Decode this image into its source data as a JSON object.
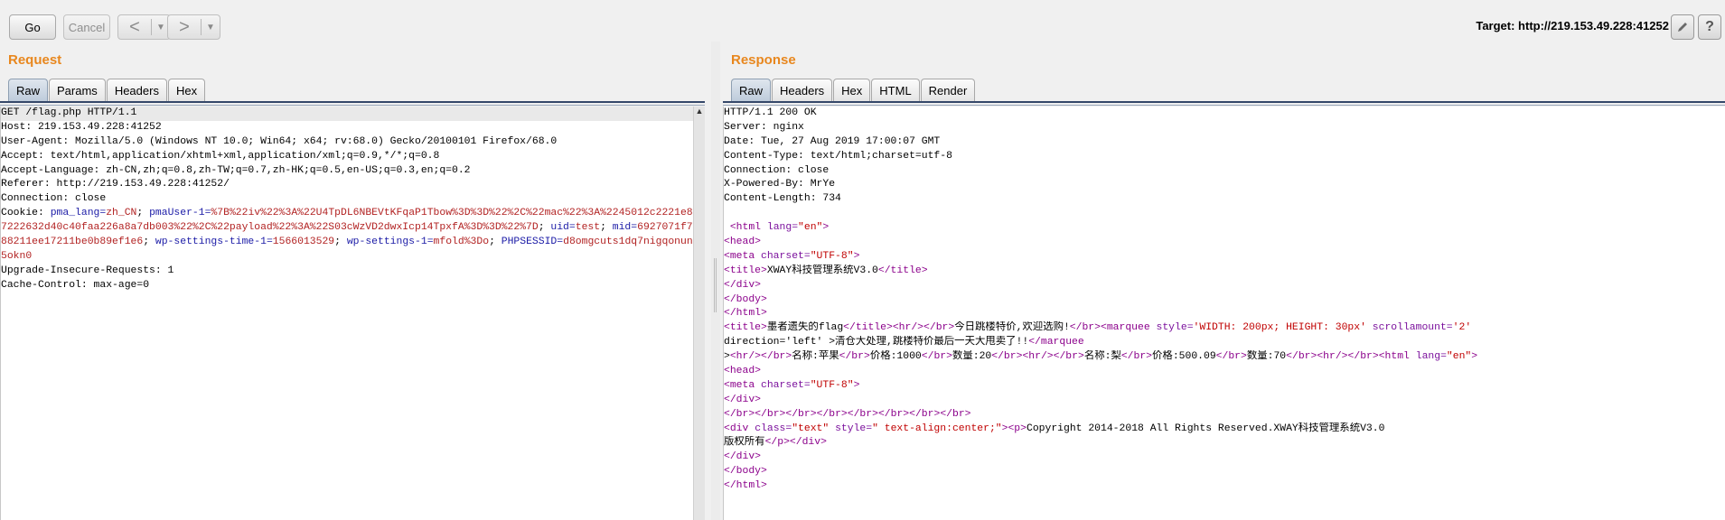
{
  "toolbar": {
    "go_label": "Go",
    "cancel_label": "Cancel",
    "back_glyph": "<",
    "forward_glyph": ">",
    "dropdown_glyph": "▼",
    "target_text": "Target: http://219.153.49.228:41252",
    "edit_icon": "pencil-icon",
    "help_icon": "help-icon"
  },
  "request": {
    "title": "Request",
    "tabs": [
      "Raw",
      "Params",
      "Headers",
      "Hex"
    ],
    "active_tab": "Raw",
    "lines": [
      "GET /flag.php HTTP/1.1",
      "Host: 219.153.49.228:41252",
      "User-Agent: Mozilla/5.0 (Windows NT 10.0; Win64; x64; rv:68.0) Gecko/20100101 Firefox/68.0",
      "Accept: text/html,application/xhtml+xml,application/xml;q=0.9,*/*;q=0.8",
      "Accept-Language: zh-CN,zh;q=0.8,zh-TW;q=0.7,zh-HK;q=0.5,en-US;q=0.3,en;q=0.2",
      "Referer: http://219.153.49.228:41252/",
      "Connection: close"
    ],
    "cookie_label": "Cookie: ",
    "cookie_parts": [
      {
        "k": "pma_lang",
        "v": "zh_CN",
        "sep": "; "
      },
      {
        "k": "pmaUser-1",
        "v": "%7B%22iv%22%3A%22U4TpDL6NBEVtKFqaP1Tbow%3D%3D%22%2C%22mac%22%3A%2245012c2221e87222632d40c40faa226a8a7db003%22%2C%22payload%22%3A%22S03cWzVD2dwxIcp14TpxfA%3D%3D%22%7D",
        "sep": "; "
      },
      {
        "k": "uid",
        "v": "test",
        "sep": "; "
      },
      {
        "k": "mid",
        "v": "6927071f788211ee17211be0b89ef1e6",
        "sep": "; "
      },
      {
        "k": "wp-settings-time-1",
        "v": "1566013529",
        "sep": "; "
      },
      {
        "k": "wp-settings-1",
        "v": "mfold%3Do",
        "sep": "; "
      },
      {
        "k": "PHPSESSID",
        "v": "d8omgcuts1dq7nigqonun5okn0",
        "sep": ""
      }
    ],
    "tail_lines": [
      "Upgrade-Insecure-Requests: 1",
      "Cache-Control: max-age=0"
    ]
  },
  "response": {
    "title": "Response",
    "tabs": [
      "Raw",
      "Headers",
      "Hex",
      "HTML",
      "Render"
    ],
    "active_tab": "Raw",
    "header_lines": [
      "HTTP/1.1 200 OK",
      "Server: nginx",
      "Date: Tue, 27 Aug 2019 17:00:07 GMT",
      "Content-Type: text/html;charset=utf-8",
      "Connection: close",
      "X-Powered-By: MrYe",
      "Content-Length: 734",
      ""
    ],
    "body_lines": [
      " <html lang=\"en\">",
      "<head>",
      "<meta charset=\"UTF-8\">",
      "<title>XWAY科技管理系统V3.0</title>",
      "</div>",
      "</body>",
      "</html>",
      "<title>墨者遗失的flag</title><hr/></br>今日跳楼特价,欢迎选购!</br><marquee style='WIDTH: 200px; HEIGHT: 30px' scrollamount='2'",
      "direction='left' >清仓大处理,跳楼特价最后一天大甩卖了!!</marquee",
      "><hr/></br>名称:苹果</br>价格:1000</br>数量:20</br><hr/></br>名称:梨</br>价格:500.09</br>数量:70</br><hr/></br><html lang=\"en\">",
      "<head>",
      "<meta charset=\"UTF-8\">",
      "</div>",
      "</br></br></br></br></br></br></br></br>",
      "<div class=\"text\" style=\" text-align:center;\"><p>Copyright 2014-2018 All Rights Reserved.XWAY科技管理系统V3.0",
      "版权所有</p></div>",
      "</div>",
      "</body>",
      "</html>"
    ]
  },
  "colors": {
    "panel_title": "#e8871e",
    "cookie_key": "#1a1aa6",
    "cookie_value": "#b22222",
    "html_tag": "#8b008b"
  }
}
